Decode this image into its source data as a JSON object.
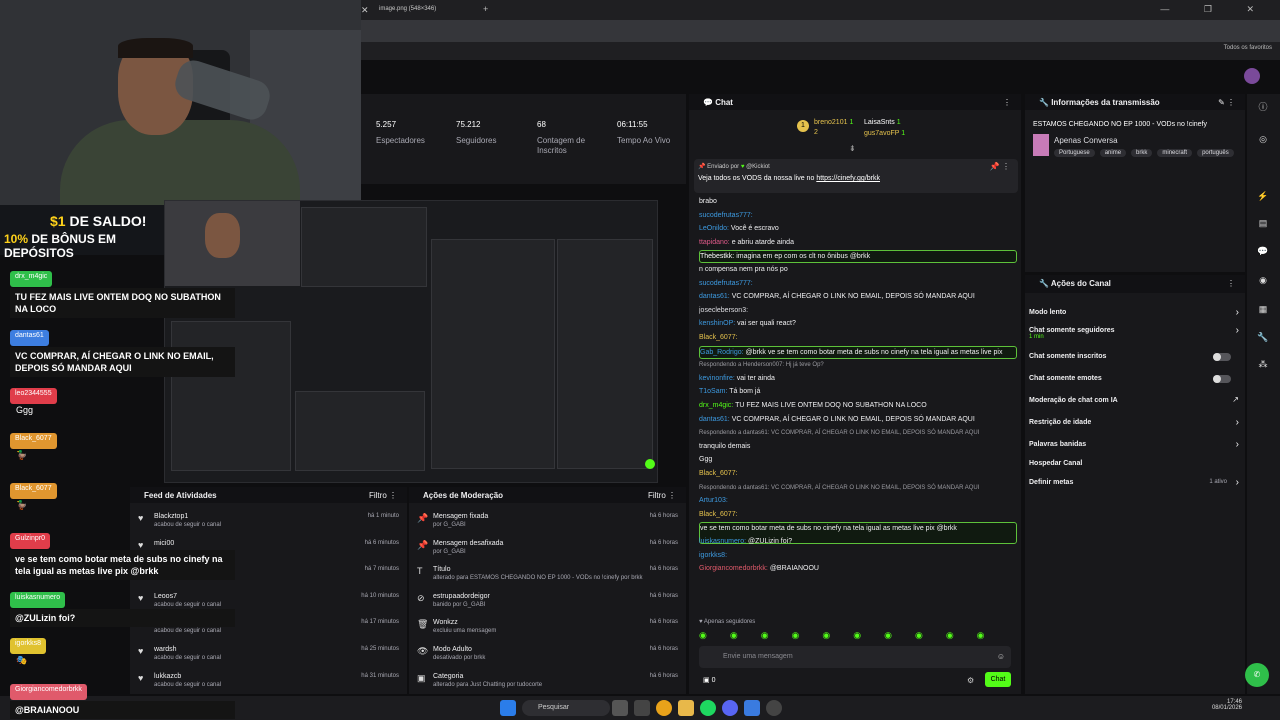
{
  "promo": {
    "prefix": "$1",
    "line1": "DE SALDO!",
    "pct": "10%",
    "line2": "DE BÔNUS EM DEPÓSITOS"
  },
  "overlay": [
    {
      "name": "drx_m4gic",
      "color": "#2fbf4a",
      "msg": "TU FEZ MAIS LIVE ONTEM DOQ NO SUBATHON NA LOCO"
    },
    {
      "name": "dantas61",
      "color": "#3d7ee0",
      "msg": "VC COMPRAR, AÍ CHEGAR O LINK NO EMAIL, DEPOIS SÓ MANDAR AQUI"
    },
    {
      "name": "leo2344555",
      "color": "#e03d4a",
      "msg": "Ggg"
    },
    {
      "name": "Black_6077",
      "color": "#e0962f",
      "msg": "🦆"
    },
    {
      "name": "Black_6077",
      "color": "#e0962f",
      "msg": "🦆"
    },
    {
      "name": "Gulzinpr0",
      "color": "#e03d4a",
      "msg": "ve se tem como botar meta de subs no cinefy na tela igual as metas live pix @brkk"
    },
    {
      "name": "luiskasnumero",
      "color": "#2fbf4a",
      "msg": "@ZULizin foi?"
    },
    {
      "name": "igorkks8",
      "color": "#e0c22f",
      "msg": "🎭"
    },
    {
      "name": "Giorgiancomedorbrkk",
      "color": "#e05a6b",
      "msg": "@BRAIANOOU"
    }
  ],
  "browser": {
    "tab_title": "image.png (548×346)",
    "bookmarks": "Todos os favoritos",
    "controls": "—  ❐  ✕"
  },
  "stats": [
    {
      "value": "5.257",
      "label": "Espectadores"
    },
    {
      "value": "75.212",
      "label": "Seguidores"
    },
    {
      "value": "68",
      "label": "Contagem de Inscritos"
    },
    {
      "value": "06:11:55",
      "label": "Tempo Ao Vivo"
    }
  ],
  "chat": {
    "title": "Chat",
    "leaders": [
      {
        "name": "breno2101",
        "n": "1"
      },
      {
        "name": "LaisaSnts",
        "n": "1"
      },
      {
        "name": "gus7avoFP",
        "n": "1"
      }
    ],
    "leader_num": "2",
    "pinned_by": "Enviado por",
    "pinned_user": "@Kickiot",
    "pinned_text": "Veja todos os VODS da nossa live no",
    "pinned_link": "https://cinefy.gg/brkk",
    "lines": [
      {
        "user": "",
        "text": "brabo",
        "reply": ""
      },
      {
        "user": "sucodefrutas777:",
        "text": "",
        "reply": ""
      },
      {
        "user": "LeOnildo:",
        "text": "Você é escravo",
        "reply": ""
      },
      {
        "user": "ttapidano:",
        "text": "e abriu atarde ainda",
        "reply": ""
      },
      {
        "user": "Thebestkk:",
        "text": "imagina em ep com os clt no ônibus @brkk",
        "reply": ""
      },
      {
        "user": "",
        "text": "n compensa nem pra nós po",
        "reply": ""
      },
      {
        "user": "sucodefrutas777:",
        "text": "",
        "reply": ""
      },
      {
        "user": "dantas61:",
        "text": "VC COMPRAR, AÍ CHEGAR O LINK NO EMAIL, DEPOIS SÓ MANDAR AQUI",
        "reply": ""
      },
      {
        "user": "josecleberson3:",
        "text": "",
        "reply": ""
      },
      {
        "user": "kenshinOP:",
        "text": "vai ser quali react?",
        "reply": ""
      },
      {
        "user": "Black_6077:",
        "text": "",
        "reply": ""
      },
      {
        "user": "Gab_Rodrigo:",
        "text": "@brkk ve se tem como botar meta de subs no cinefy na tela igual as metas live pix",
        "reply": ""
      },
      {
        "user": "",
        "text": "",
        "reply": "Respondendo a Henderson007: Hj já teve Op?"
      },
      {
        "user": "kevinonfire:",
        "text": "vai ter ainda",
        "reply": ""
      },
      {
        "user": "T1oSam:",
        "text": "Tá bom já",
        "reply": ""
      },
      {
        "user": "drx_m4gic:",
        "text": "TU FEZ MAIS LIVE ONTEM DOQ NO SUBATHON NA LOCO",
        "reply": ""
      },
      {
        "user": "dantas61:",
        "text": "VC COMPRAR, AÍ CHEGAR O LINK NO EMAIL, DEPOIS SÓ MANDAR AQUI",
        "reply": ""
      },
      {
        "user": "",
        "text": "",
        "reply": "Respondendo a dantas61: VC COMPRAR, AÍ CHEGAR O LINK NO EMAIL, DEPOIS SÓ MANDAR AQUI"
      },
      {
        "user": "",
        "text": "tranquilo demais",
        "reply": ""
      },
      {
        "user": "",
        "text": "Ggg",
        "reply": ""
      },
      {
        "user": "Black_6077:",
        "text": "",
        "reply": ""
      },
      {
        "user": "",
        "text": "",
        "reply": "Respondendo a dantas61: VC COMPRAR, AÍ CHEGAR O LINK NO EMAIL, DEPOIS SÓ MANDAR AQUI"
      },
      {
        "user": "Artur103:",
        "text": "",
        "reply": ""
      },
      {
        "user": "Black_6077:",
        "text": "",
        "reply": ""
      },
      {
        "user": "",
        "text": "ve se tem como botar meta de subs no cinefy na tela igual as metas live pix @brkk",
        "reply": ""
      },
      {
        "user": "luiskasnumero:",
        "text": "@ZULizin foi?",
        "reply": ""
      },
      {
        "user": "igorkks8:",
        "text": "",
        "reply": ""
      },
      {
        "user": "Giorgiancomedorbrkk:",
        "text": "@BRAIANOOU",
        "reply": ""
      }
    ],
    "followers_only": "Apenas seguidores",
    "placeholder": "Envie uma mensagem",
    "count": "0",
    "send": "Chat"
  },
  "info": {
    "title": "Informações da transmissão",
    "stream_title": "ESTAMOS CHEGANDO NO EP 1000 - VODs no !cinefy",
    "category": "Apenas Conversa",
    "tags": [
      "Portuguese",
      "anime",
      "brkk",
      "minecraft",
      "português"
    ]
  },
  "actions": {
    "title": "Ações do Canal",
    "items": [
      {
        "label": "Modo lento",
        "sub": "",
        "kind": "arrow"
      },
      {
        "label": "Chat somente seguidores",
        "sub": "1 min",
        "kind": "arrow"
      },
      {
        "label": "Chat somente inscritos",
        "sub": "",
        "kind": "toggle"
      },
      {
        "label": "Chat somente emotes",
        "sub": "",
        "kind": "toggle"
      },
      {
        "label": "Moderação de chat com IA",
        "sub": "",
        "kind": "ext"
      },
      {
        "label": "Restrição de idade",
        "sub": "",
        "kind": "arrow"
      },
      {
        "label": "Palavras banidas",
        "sub": "",
        "kind": "arrow"
      },
      {
        "label": "Hospedar Canal",
        "sub": "",
        "kind": "none"
      },
      {
        "label": "Definir metas",
        "sub": "",
        "kind": "arrow",
        "badge": "1 ativo"
      }
    ]
  },
  "activity": {
    "title": "Feed de Atividades",
    "filter": "Filtro",
    "items": [
      {
        "name": "Blackztop1",
        "sub": "acabou de seguir o canal",
        "time": "há 1 minuto"
      },
      {
        "name": "mici00",
        "sub": "",
        "time": "há 6 minutos"
      },
      {
        "name": "babayagaZRO",
        "sub": "",
        "time": "há 7 minutos"
      },
      {
        "name": "Leoos7",
        "sub": "acabou de seguir o canal",
        "time": "há 10 minutos"
      },
      {
        "name": "aikon_vyxx",
        "sub": "acabou de seguir o canal",
        "time": "há 17 minutos"
      },
      {
        "name": "wardsh",
        "sub": "acabou de seguir o canal",
        "time": "há 25 minutos"
      },
      {
        "name": "lukkazcb",
        "sub": "acabou de seguir o canal",
        "time": "há 31 minutos"
      }
    ]
  },
  "mod": {
    "title": "Ações de Moderação",
    "filter": "Filtro",
    "items": [
      {
        "name": "Mensagem fixada",
        "sub": "por G_GABI",
        "time": "há 6 horas"
      },
      {
        "name": "Mensagem desafixada",
        "sub": "por G_GABI",
        "time": "há 6 horas"
      },
      {
        "name": "Título",
        "sub": "alterado para ESTAMOS CHEGANDO NO EP 1000 - VODs no !cinefy por brkk",
        "time": "há 6 horas"
      },
      {
        "name": "estrupaadordeigor",
        "sub": "banido por G_GABI",
        "time": "há 6 horas"
      },
      {
        "name": "Wonkzz",
        "sub": "excluiu uma mensagem",
        "time": "há 6 horas"
      },
      {
        "name": "Modo Adulto",
        "sub": "desativado por brkk",
        "time": "há 6 horas"
      },
      {
        "name": "Categoria",
        "sub": "alterado para Just Chatting por tudocorte",
        "time": "há 6 horas"
      }
    ]
  },
  "taskbar": {
    "search": "Pesquisar",
    "time": "17:46",
    "date": "08/01/2026"
  }
}
